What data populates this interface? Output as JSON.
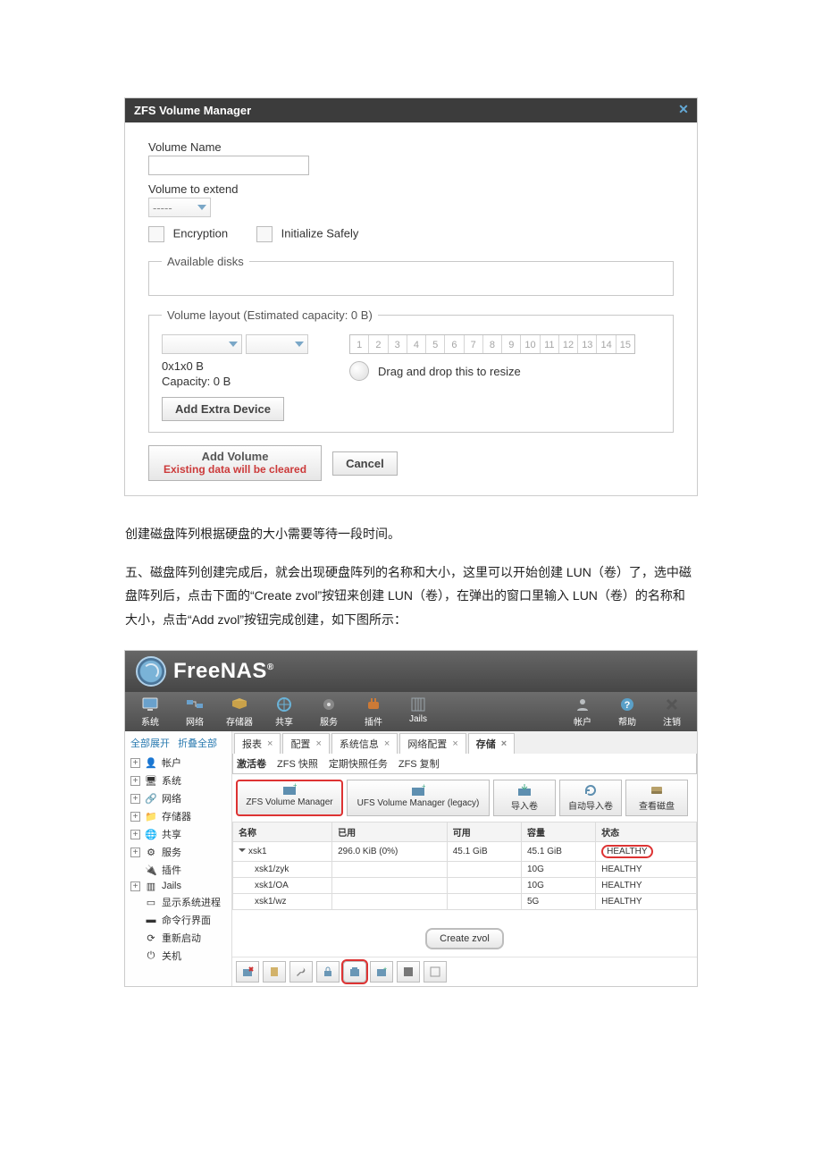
{
  "dialog": {
    "title": "ZFS Volume Manager",
    "volume_name_label": "Volume Name",
    "volume_name_value": "",
    "volume_extend_label": "Volume to extend",
    "volume_extend_value": "-----",
    "encryption_label": "Encryption",
    "init_safely_label": "Initialize Safely",
    "available_disks_legend": "Available disks",
    "volume_layout_legend": "Volume layout (Estimated capacity: 0 B)",
    "grid_value": "0x1x0 B",
    "capacity_line": "Capacity: 0 B",
    "resize_hint": "Drag and drop this to resize",
    "add_extra_device": "Add Extra Device",
    "add_volume_t1": "Add Volume",
    "add_volume_t2": "Existing data will be cleared",
    "cancel": "Cancel",
    "slots": [
      "1",
      "2",
      "3",
      "4",
      "5",
      "6",
      "7",
      "8",
      "9",
      "10",
      "11",
      "12",
      "13",
      "14",
      "15"
    ]
  },
  "doc": {
    "p1": "创建磁盘阵列根据硬盘的大小需要等待一段时间。",
    "p2": "五、磁盘阵列创建完成后，就会出现硬盘阵列的名称和大小，这里可以开始创建 LUN（卷）了，选中磁盘阵列后，点击下面的“Create zvol”按钮来创建 LUN（卷），在弹出的窗口里输入 LUN（卷）的名称和大小，点击“Add zvol”按钮完成创建，如下图所示："
  },
  "app": {
    "brand": "FreeNAS",
    "toolbar": [
      {
        "id": "system",
        "label": "系统"
      },
      {
        "id": "network",
        "label": "网络"
      },
      {
        "id": "storage",
        "label": "存储器"
      },
      {
        "id": "share",
        "label": "共享"
      },
      {
        "id": "services",
        "label": "服务"
      },
      {
        "id": "plugins",
        "label": "插件"
      },
      {
        "id": "jails",
        "label": "Jails"
      }
    ],
    "toolbar_right": [
      {
        "id": "account",
        "label": "帐户"
      },
      {
        "id": "help",
        "label": "帮助"
      },
      {
        "id": "logout",
        "label": "注销"
      }
    ],
    "sidebar_top": {
      "expand": "全部展开",
      "collapse": "折叠全部"
    },
    "tree": [
      {
        "id": "account",
        "label": "帐户"
      },
      {
        "id": "system",
        "label": "系统"
      },
      {
        "id": "network",
        "label": "网络"
      },
      {
        "id": "storage",
        "label": "存储器"
      },
      {
        "id": "share",
        "label": "共享"
      },
      {
        "id": "services",
        "label": "服务"
      },
      {
        "id": "plugins",
        "label": "插件"
      },
      {
        "id": "jails",
        "label": "Jails"
      },
      {
        "id": "sysproc",
        "label": "显示系统进程"
      },
      {
        "id": "cli",
        "label": "命令行界面"
      },
      {
        "id": "reboot",
        "label": "重新启动"
      },
      {
        "id": "shutdown",
        "label": "关机"
      }
    ],
    "tabs": [
      {
        "id": "report",
        "label": "报表"
      },
      {
        "id": "settings",
        "label": "配置"
      },
      {
        "id": "sysinfo",
        "label": "系统信息"
      },
      {
        "id": "netcfg",
        "label": "网络配置"
      },
      {
        "id": "storage",
        "label": "存储",
        "active": true
      }
    ],
    "subtabs": [
      {
        "id": "active-volume",
        "label": "激活卷",
        "active": true
      },
      {
        "id": "zfs-snap",
        "label": "ZFS 快照"
      },
      {
        "id": "periodic",
        "label": "定期快照任务"
      },
      {
        "id": "zfs-repl",
        "label": "ZFS 复制"
      }
    ],
    "cmds": [
      {
        "id": "zfs-mgr",
        "label": "ZFS Volume Manager",
        "selected": true
      },
      {
        "id": "ufs-mgr",
        "label": "UFS Volume Manager (legacy)"
      },
      {
        "id": "import",
        "label": "导入卷"
      },
      {
        "id": "auto-import",
        "label": "自动导入卷"
      },
      {
        "id": "view-disks",
        "label": "查看磁盘"
      }
    ],
    "grid_headers": {
      "name": "名称",
      "used": "已用",
      "avail": "可用",
      "cap": "容量",
      "status": "状态"
    },
    "grid_rows": [
      {
        "name": "xsk1",
        "used": "296.0 KiB (0%)",
        "avail": "45.1 GiB",
        "cap": "45.1 GiB",
        "status": "HEALTHY",
        "top": true,
        "status_ring": true
      },
      {
        "name": "xsk1/zyk",
        "used": "",
        "avail": "",
        "cap": "10G",
        "status": "HEALTHY"
      },
      {
        "name": "xsk1/OA",
        "used": "",
        "avail": "",
        "cap": "10G",
        "status": "HEALTHY"
      },
      {
        "name": "xsk1/wz",
        "used": "",
        "avail": "",
        "cap": "5G",
        "status": "HEALTHY"
      }
    ],
    "create_zvol": "Create zvol"
  }
}
